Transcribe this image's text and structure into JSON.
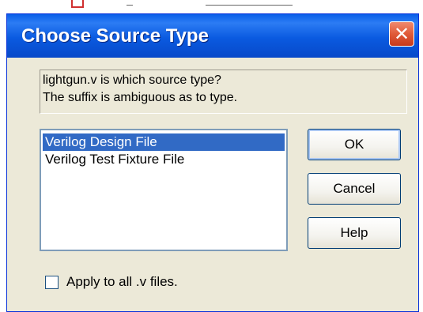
{
  "dialog": {
    "title": "Choose Source Type",
    "close_glyph": "✕",
    "message_lines": [
      "lightgun.v is which source type?",
      "The suffix is ambiguous as to type."
    ],
    "source_types": [
      {
        "label": "Verilog Design File",
        "selected": true
      },
      {
        "label": "Verilog Test Fixture File",
        "selected": false
      }
    ],
    "buttons": {
      "ok": "OK",
      "cancel": "Cancel",
      "help": "Help"
    },
    "apply_all": {
      "label": "Apply to all .v files.",
      "checked": false
    }
  },
  "colors": {
    "title_bar": "#0a5ae0",
    "close_button": "#e05a38",
    "selection": "#316ac5",
    "dialog_face": "#ece9d8"
  }
}
